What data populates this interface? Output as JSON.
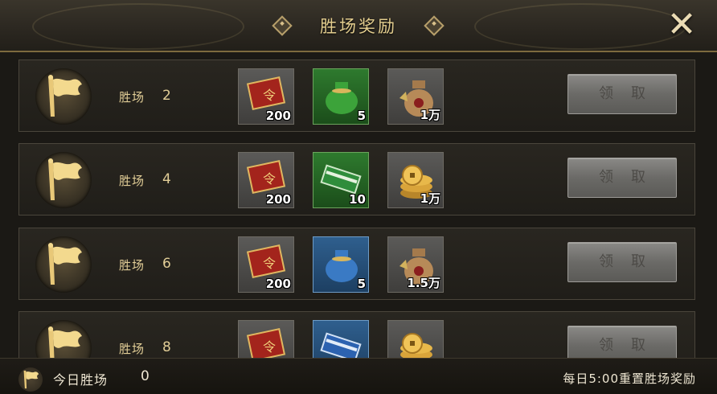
{
  "header": {
    "title": "胜场奖励"
  },
  "rows": [
    {
      "label": "胜场",
      "wins": "2",
      "items": [
        {
          "icon": "red-card-icon",
          "qty": "200"
        },
        {
          "icon": "green-pouch-icon",
          "qty": "5"
        },
        {
          "icon": "money-bag-icon",
          "qty": "1万"
        }
      ],
      "claim_label": "领取"
    },
    {
      "label": "胜场",
      "wins": "4",
      "items": [
        {
          "icon": "red-card-icon",
          "qty": "200"
        },
        {
          "icon": "green-book-icon",
          "qty": "10"
        },
        {
          "icon": "coin-stack-icon",
          "qty": "1万"
        }
      ],
      "claim_label": "领取"
    },
    {
      "label": "胜场",
      "wins": "6",
      "items": [
        {
          "icon": "red-card-icon",
          "qty": "200"
        },
        {
          "icon": "blue-pouch-icon",
          "qty": "5"
        },
        {
          "icon": "money-bag-icon",
          "qty": "1.5万"
        }
      ],
      "claim_label": "领取"
    },
    {
      "label": "胜场",
      "wins": "8",
      "items": [
        {
          "icon": "red-card-icon",
          "qty": ""
        },
        {
          "icon": "blue-book-icon",
          "qty": ""
        },
        {
          "icon": "coin-stack-icon",
          "qty": ""
        }
      ],
      "claim_label": "领取"
    }
  ],
  "footer": {
    "today_label": "今日胜场",
    "today_value": "0",
    "reset_note": "每日5:00重置胜场奖励"
  }
}
